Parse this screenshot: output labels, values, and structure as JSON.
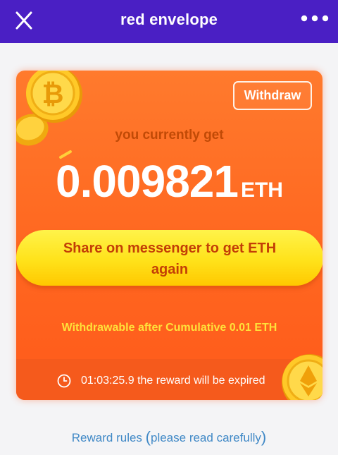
{
  "header": {
    "title": "red envelope",
    "close_icon": "close-icon",
    "more_icon": "more-icon"
  },
  "card": {
    "withdraw_label": "Withdraw",
    "currently_text": "you currently get",
    "amount": "0.009821",
    "currency": "ETH",
    "share_line1": "Share on messenger to get ETH",
    "share_line2": "again",
    "withdrawable_text": "Withdrawable after Cumulative 0.01 ETH",
    "expiry_time": "01:03:25.9",
    "expiry_suffix": "the reward will be expired",
    "icons": [
      "bitcoin-coin-icon",
      "ethereum-coin-icon",
      "clock-icon"
    ]
  },
  "footer": {
    "rules_text": "Reward rules",
    "rules_paren_open": "(",
    "rules_note": "please read carefully",
    "rules_paren_close": ")"
  },
  "colors": {
    "header_bg": "#4a1fc4",
    "card_orange": "#ff6a22",
    "share_yellow": "#ffe21a",
    "link_blue": "#3f88c6"
  }
}
